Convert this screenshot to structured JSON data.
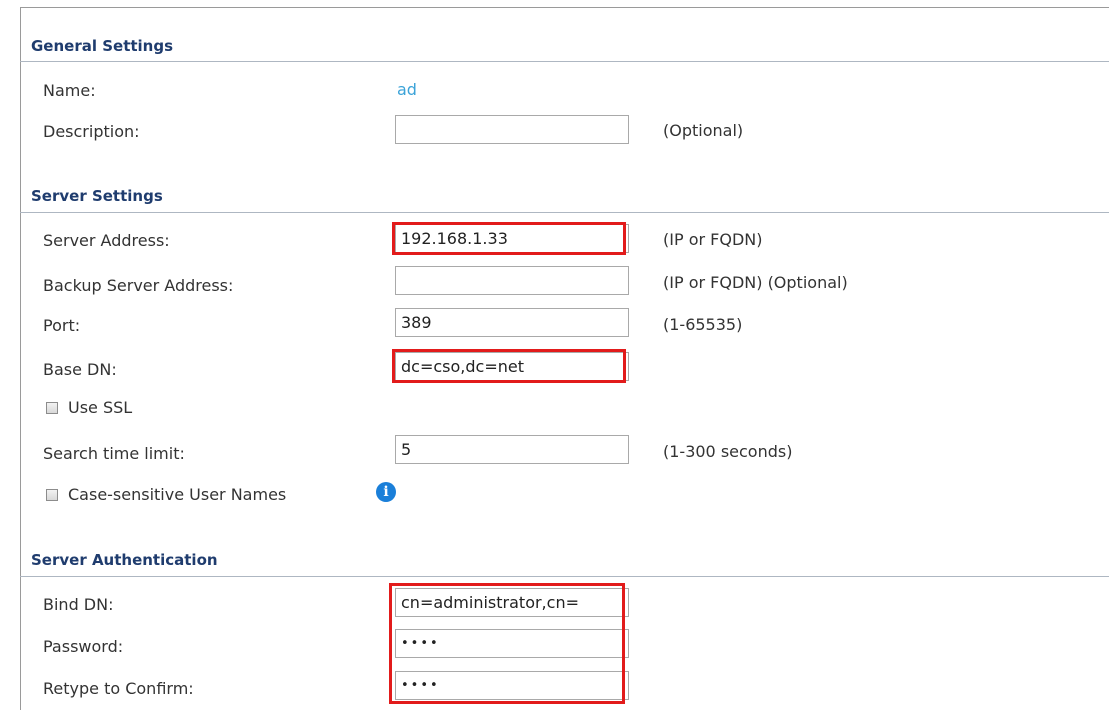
{
  "general": {
    "title": "General Settings",
    "name_label": "Name:",
    "name_value": "ad",
    "description_label": "Description:",
    "description_value": "",
    "description_hint": "(Optional)"
  },
  "server": {
    "title": "Server Settings",
    "address_label": "Server Address:",
    "address_value": "192.168.1.33",
    "address_hint": "(IP or FQDN)",
    "backup_label": "Backup Server Address:",
    "backup_value": "",
    "backup_hint": "(IP or FQDN) (Optional)",
    "port_label": "Port:",
    "port_value": "389",
    "port_hint": "(1-65535)",
    "basedn_label": "Base DN:",
    "basedn_value": "dc=cso,dc=net",
    "use_ssl_label": "Use SSL",
    "use_ssl_checked": false,
    "search_label": "Search time limit:",
    "search_value": "5",
    "search_hint": "(1-300 seconds)",
    "case_label": "Case-sensitive User Names",
    "case_checked": false
  },
  "auth": {
    "title": "Server Authentication",
    "binddn_label": "Bind DN:",
    "binddn_value": "cn=administrator,cn=",
    "password_label": "Password:",
    "password_value": "••••",
    "retype_label": "Retype to Confirm:",
    "retype_value": "••••"
  },
  "colors": {
    "section_title": "#1f3c6e",
    "name_value": "#3ba3d8",
    "highlight": "#e21b1b",
    "info_icon": "#1a7fd9"
  },
  "icons": {
    "info": "info-icon"
  }
}
